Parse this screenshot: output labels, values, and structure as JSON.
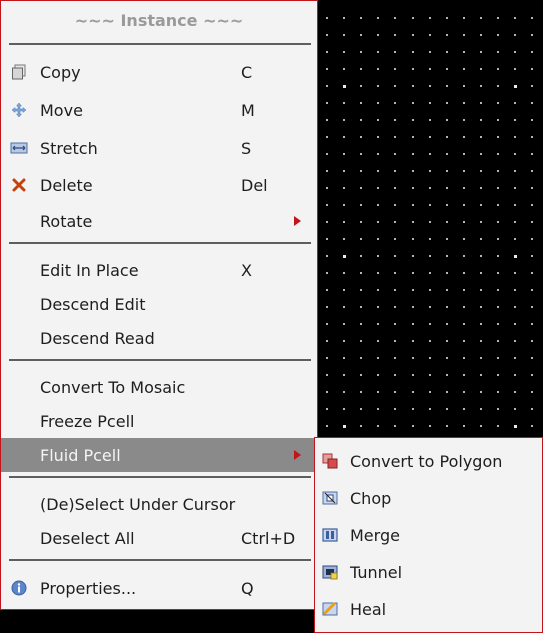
{
  "menu": {
    "title": "~~~ Instance ~~~",
    "items": [
      {
        "label": "Copy",
        "shortcut": "C",
        "icon": "copy-icon"
      },
      {
        "label": "Move",
        "shortcut": "M",
        "icon": "move-icon"
      },
      {
        "label": "Stretch",
        "shortcut": "S",
        "icon": "stretch-icon"
      },
      {
        "label": "Delete",
        "shortcut": "Del",
        "icon": "delete-icon"
      },
      {
        "label": "Rotate",
        "shortcut": ""
      },
      {
        "label": "Edit In Place",
        "shortcut": "X"
      },
      {
        "label": "Descend Edit",
        "shortcut": ""
      },
      {
        "label": "Descend Read",
        "shortcut": ""
      },
      {
        "label": "Convert To Mosaic",
        "shortcut": ""
      },
      {
        "label": "Freeze Pcell",
        "shortcut": ""
      },
      {
        "label": "Fluid Pcell",
        "shortcut": ""
      },
      {
        "label": "(De)Select Under Cursor",
        "shortcut": ""
      },
      {
        "label": "Deselect All",
        "shortcut": "Ctrl+D"
      },
      {
        "label": "Properties...",
        "shortcut": "Q",
        "icon": "info-icon"
      }
    ]
  },
  "submenu": {
    "items": [
      {
        "label": "Convert to Polygon",
        "icon": "convert-polygon-icon"
      },
      {
        "label": "Chop",
        "icon": "chop-icon"
      },
      {
        "label": "Merge",
        "icon": "merge-icon"
      },
      {
        "label": "Tunnel",
        "icon": "tunnel-icon"
      },
      {
        "label": "Heal",
        "icon": "heal-icon"
      }
    ]
  },
  "colors": {
    "menu_bg": "#f3f3f3",
    "menu_border": "#c2151b",
    "highlight_bg": "#8a8a8a",
    "canvas_bg": "#000000",
    "submenu_arrow": "#c0151b"
  }
}
